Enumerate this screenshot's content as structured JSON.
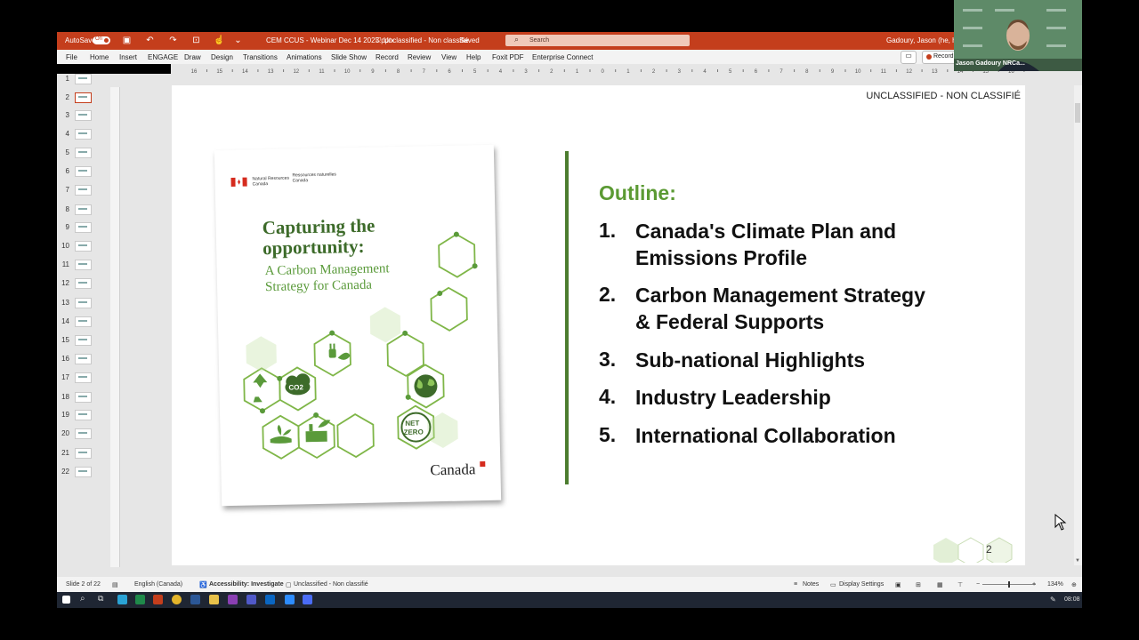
{
  "titlebar": {
    "autosave_label": "AutoSave",
    "autosave_state": "On",
    "file_title": "CEM CCUS - Webinar Dec 14 2023.pptx",
    "classification": "Unclassified - Non classifié",
    "save_state": "Saved",
    "search_placeholder": "Search",
    "user": "Gadoury, Jason (he, him |"
  },
  "menu": [
    "File",
    "Home",
    "Insert",
    "ENGAGE",
    "Draw",
    "Design",
    "Transitions",
    "Animations",
    "Slide Show",
    "Record",
    "Review",
    "View",
    "Help",
    "Foxit PDF",
    "Enterprise Connect"
  ],
  "record_button": "Record",
  "ruler_labels": [
    "16",
    "15",
    "14",
    "13",
    "12",
    "11",
    "10",
    "9",
    "8",
    "7",
    "6",
    "5",
    "4",
    "3",
    "2",
    "1",
    "0",
    "1",
    "2",
    "3",
    "4",
    "5",
    "6",
    "7",
    "8",
    "9",
    "10",
    "11",
    "12",
    "13",
    "14",
    "15",
    "16"
  ],
  "slide_numbers": [
    "1",
    "2",
    "3",
    "4",
    "5",
    "6",
    "7",
    "8",
    "9",
    "10",
    "11",
    "12",
    "13",
    "14",
    "15",
    "16",
    "17",
    "18",
    "19",
    "20",
    "21",
    "22"
  ],
  "selected_slide": 2,
  "slide": {
    "classification": "UNCLASSIFIED - NON CLASSIFIÉ",
    "outline_title": "Outline:",
    "outline_items": [
      {
        "num": "1.",
        "text": "Canada's Climate Plan and Emissions Profile"
      },
      {
        "num": "2.",
        "text": "Carbon Management Strategy & Federal Supports"
      },
      {
        "num": "3.",
        "text": "Sub-national Highlights"
      },
      {
        "num": "4.",
        "text": "Industry Leadership"
      },
      {
        "num": "5.",
        "text": "International Collaboration"
      }
    ],
    "page_number": "2",
    "cover": {
      "org_en_1": "Natural Resources",
      "org_en_2": "Canada",
      "org_fr_1": "Ressources naturelles",
      "org_fr_2": "Canada",
      "title_1": "Capturing the",
      "title_2": "opportunity:",
      "subtitle_1": "A Carbon Management",
      "subtitle_2": "Strategy for Canada",
      "co2": "CO2",
      "net": "NET",
      "zero": "ZERO",
      "wordmark": "Canada"
    }
  },
  "statusbar": {
    "slide_of": "Slide 2 of 22",
    "language": "English (Canada)",
    "accessibility": "Accessibility: Investigate",
    "classification": "Unclassified - Non classifié",
    "notes": "Notes",
    "display_settings": "Display Settings",
    "zoom": "134%"
  },
  "taskbar": {
    "time": "08:08"
  },
  "webcam": {
    "participant": "Jason Gadoury NRCa..."
  },
  "colors": {
    "accent": "#c43e1c",
    "green": "#5b9a33",
    "dark_green": "#4c7d2f"
  }
}
